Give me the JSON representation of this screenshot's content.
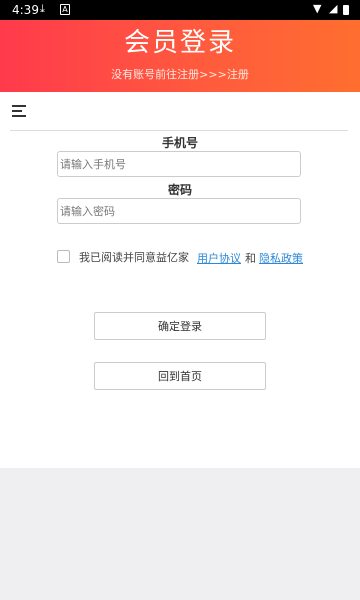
{
  "status_bar": {
    "time": "4:39",
    "icons": [
      "download-icon",
      "a-icon",
      "wifi-icon",
      "cellular-icon",
      "battery-icon"
    ]
  },
  "header": {
    "title": "会员登录",
    "subtitle": "没有账号前往注册>>>注册"
  },
  "form": {
    "phone_label": "手机号",
    "phone_placeholder": "请输入手机号",
    "password_label": "密码",
    "password_placeholder": "请输入密码"
  },
  "agreement": {
    "text": "我已阅读并同意益亿家",
    "user_agreement": "用户协议",
    "and": "和",
    "privacy_policy": "隐私政策",
    "checked": false
  },
  "buttons": {
    "login": "确定登录",
    "home": "回到首页"
  },
  "colors": {
    "header_gradient_start": "#ff3a4c",
    "header_gradient_end": "#ff6e2f",
    "link": "#2a88d8",
    "footer_bg": "#efeff2"
  }
}
